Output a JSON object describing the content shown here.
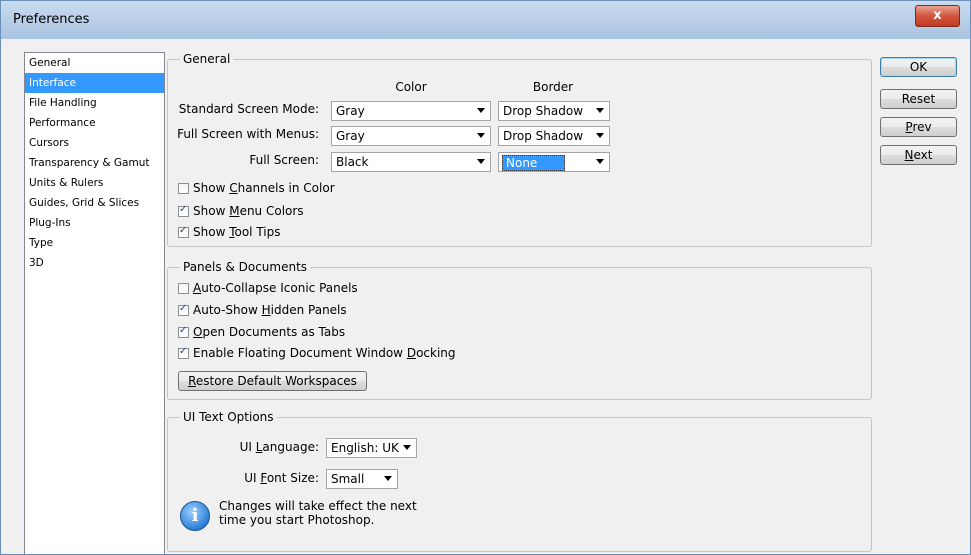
{
  "window": {
    "title": "Preferences",
    "close_label": "x"
  },
  "sidebar": {
    "items": [
      {
        "label": "General"
      },
      {
        "label": "Interface"
      },
      {
        "label": "File Handling"
      },
      {
        "label": "Performance"
      },
      {
        "label": "Cursors"
      },
      {
        "label": "Transparency & Gamut"
      },
      {
        "label": "Units & Rulers"
      },
      {
        "label": "Guides, Grid & Slices"
      },
      {
        "label": "Plug-Ins"
      },
      {
        "label": "Type"
      },
      {
        "label": "3D"
      }
    ],
    "selected": "Interface"
  },
  "general": {
    "legend": "General",
    "col_color": "Color",
    "col_border": "Border",
    "rows": [
      {
        "label": "Standard Screen Mode:",
        "color": "Gray",
        "border": "Drop Shadow"
      },
      {
        "label": "Full Screen with Menus:",
        "color": "Gray",
        "border": "Drop Shadow"
      },
      {
        "label": "Full Screen:",
        "color": "Black",
        "border": "None"
      }
    ],
    "checks": [
      {
        "pre": "Show ",
        "ul": "C",
        "post": "hannels in Color",
        "checked": false
      },
      {
        "pre": "Show ",
        "ul": "M",
        "post": "enu Colors",
        "checked": true
      },
      {
        "pre": "Show ",
        "ul": "T",
        "post": "ool Tips",
        "checked": true
      }
    ]
  },
  "panels": {
    "legend": "Panels & Documents",
    "checks": [
      {
        "pre": "",
        "ul": "A",
        "post": "uto-Collapse Iconic Panels",
        "checked": false
      },
      {
        "pre": "Auto-Show ",
        "ul": "H",
        "post": "idden Panels",
        "checked": true
      },
      {
        "pre": "",
        "ul": "O",
        "post": "pen Documents as Tabs",
        "checked": true
      },
      {
        "pre": "Enable Floating Document Window ",
        "ul": "D",
        "post": "ocking",
        "checked": true
      }
    ],
    "restore_pre": "",
    "restore_ul": "R",
    "restore_post": "estore Default Workspaces"
  },
  "uitext": {
    "legend": "UI Text Options",
    "language_pre": "UI ",
    "language_ul": "L",
    "language_post": "anguage:",
    "language_value": "English: UK",
    "fontsize_pre": "UI ",
    "fontsize_ul": "F",
    "fontsize_post": "ont Size:",
    "fontsize_value": "Small",
    "note_line1": "Changes will take effect the next",
    "note_line2": "time you start Photoshop.",
    "info_glyph": "i"
  },
  "buttons": {
    "ok": "OK",
    "reset": "Reset",
    "prev_ul": "P",
    "prev_post": "rev",
    "next_ul": "N",
    "next_post": "ext"
  }
}
